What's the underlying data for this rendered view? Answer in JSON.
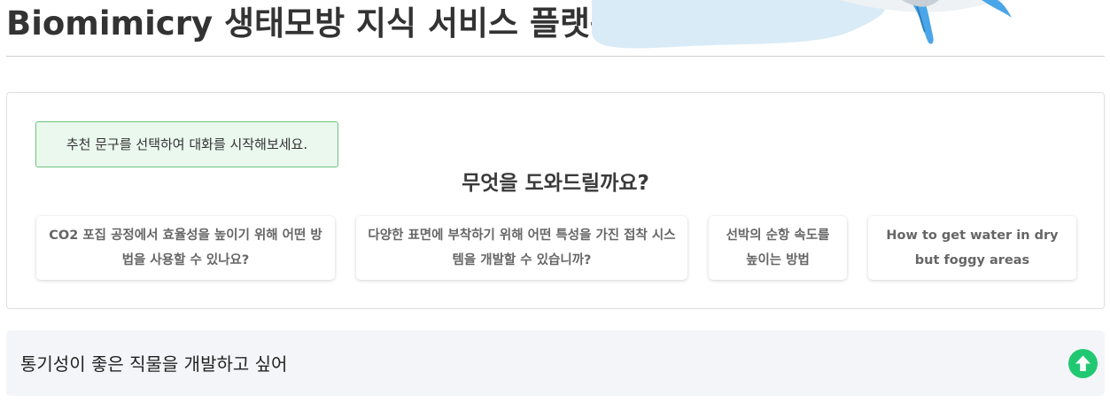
{
  "header": {
    "title": "Biomimicry 생태모방 지식 서비스 플랫폼"
  },
  "chat": {
    "notice": "추천 문구를 선택하여 대화를 시작해보세요.",
    "question": "무엇을 도와드릴까요?",
    "suggestions": [
      {
        "label": "CO2 포집 공정에서 효율성을 높이기 위해 어떤 방법을 사용할 수 있나요?"
      },
      {
        "label": "다양한 표면에 부착하기 위해 어떤 특성을 가진 접착 시스템을 개발할 수 있습니까?"
      },
      {
        "label": "선박의 순항 속도를 높이는 방법"
      },
      {
        "label": "How to get water in dry but foggy areas"
      }
    ]
  },
  "input": {
    "value": "통기성이 좋은 직물을 개발하고 싶어"
  },
  "colors": {
    "accent": "#21c872",
    "notice_bg": "#eaf8ee",
    "notice_border": "#6bc27f",
    "input_bg": "#f4f5f8"
  },
  "icons": {
    "send": "arrow-up-circle-icon",
    "header_art": "whale-illustration"
  }
}
